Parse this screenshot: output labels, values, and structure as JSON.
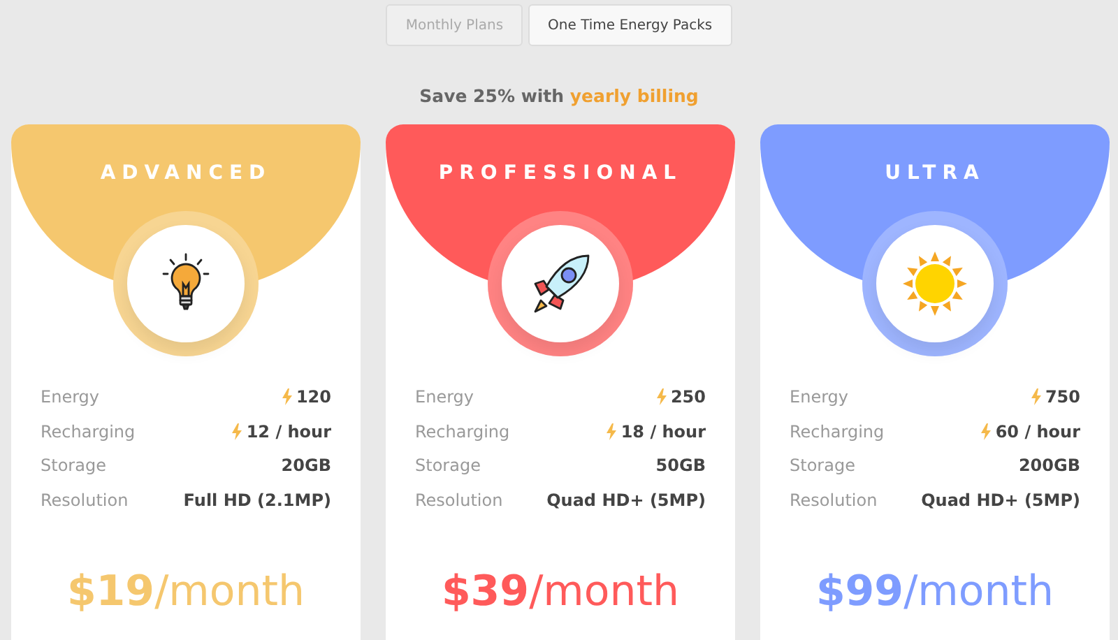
{
  "tabs": [
    {
      "label": "Monthly Plans",
      "selected": false
    },
    {
      "label": "One Time Energy Packs",
      "selected": true
    }
  ],
  "promo": "Save 25% with **yearly billing**",
  "plans": [
    {
      "name": "ADVANCED",
      "color": "#f5c76e",
      "features": [
        {
          "label": "Energy",
          "value": "120",
          "bolt": true
        },
        {
          "label": "Recharging",
          "value": "12 / hour",
          "bolt": true
        },
        {
          "label": "Storage",
          "value": "20GB",
          "bolt": false
        },
        {
          "label": "Resolution",
          "value": "Full HD (2.1MP)",
          "bolt": false
        }
      ],
      "price": "$19",
      "period": "/month"
    },
    {
      "name": "PROFESSIONAL",
      "color": "#ff5a5a",
      "features": [
        {
          "label": "Energy",
          "value": "250",
          "bolt": true
        },
        {
          "label": "Recharging",
          "value": "18 / hour",
          "bolt": true
        },
        {
          "label": "Storage",
          "value": "50GB",
          "bolt": false
        },
        {
          "label": "Resolution",
          "value": "Quad HD+ (5MP)",
          "bolt": false
        }
      ],
      "price": "$39",
      "period": "/month"
    },
    {
      "name": "ULTRA",
      "color": "#7e9cff",
      "features": [
        {
          "label": "Energy",
          "value": "750",
          "bolt": true
        },
        {
          "label": "Recharging",
          "value": "60 / hour",
          "bolt": true
        },
        {
          "label": "Storage",
          "value": "200GB",
          "bolt": false
        },
        {
          "label": "Resolution",
          "value": "Quad HD+ (5MP)",
          "bolt": false
        }
      ],
      "price": "$99",
      "period": "/month"
    }
  ]
}
